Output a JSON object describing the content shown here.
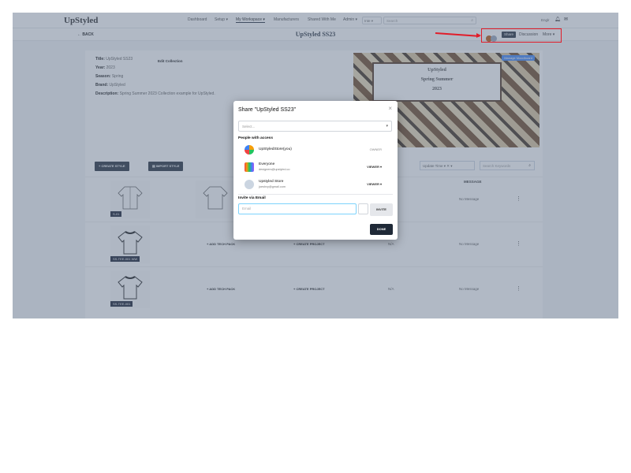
{
  "nav": {
    "logo": "UpStyled",
    "items": [
      "Dashboard",
      "Setup ▾",
      "My Workspace ▾",
      "Manufacturers",
      "Shared With Me",
      "Admin ▾"
    ],
    "lang": "Inte ▾",
    "search_placeholder": "Search",
    "right_label": "Englr"
  },
  "header": {
    "back": "← BACK",
    "title": "UpStyled SS23",
    "share": "Share",
    "discussion": "Discussion",
    "more": "More ▾"
  },
  "collection": {
    "title_label": "Title:",
    "title_value": "UpStyled SS23",
    "edit": "Edit Collection",
    "year_label": "Year:",
    "year_value": "2023",
    "season_label": "Season:",
    "season_value": "Spring",
    "brand_label": "Brand:",
    "brand_value": "UpStyled",
    "description_label": "Description:",
    "description_value": "Spring Summer 2023 Collection example for UpStyled.",
    "banner_line1": "UpStyled",
    "banner_line2": "Spring Summer",
    "banner_line3": "2023",
    "manage_moodboard": "Manage Moodboard"
  },
  "toolbar": {
    "create_style": "+ CREATE STYLE",
    "import_style": "▤ IMPORT STYLE",
    "sort": "Update Time ▾   ✕ ▾",
    "search_placeholder": "Search Keywords"
  },
  "table": {
    "headers": [
      "DESIGN",
      "TECH PACK",
      "MESSAGE"
    ],
    "rows": [
      {
        "sku": "S-01",
        "tech_pack": "",
        "project": "",
        "status": "",
        "message": "No Message"
      },
      {
        "sku": "SS-TEE-001 WW",
        "tech_pack": "+ ADD TECH PACK",
        "project": "+ CREATE PROJECT",
        "status": "N/A",
        "message": "No Message"
      },
      {
        "sku": "SS-TEE-001",
        "tech_pack": "+ ADD TECH PACK",
        "project": "+ CREATE PROJECT",
        "status": "N/A",
        "message": "No Message"
      }
    ]
  },
  "modal": {
    "title": "Share \"UpStyled SS23\"",
    "close": "×",
    "select_placeholder": "Select...",
    "people_heading": "People with access",
    "people": [
      {
        "name": "UpStyledStore(you)",
        "email": "",
        "role": "OWNER"
      },
      {
        "name": "Everyone",
        "email": "designers@upstyled.co",
        "role": "VIEWER ▾"
      },
      {
        "name": "Upstyled Store",
        "email": "joeshvy@gmail.com",
        "role": "VIEWER ▾"
      }
    ],
    "invite_heading": "Invite via Email",
    "email_placeholder": "Email",
    "invite_button": "INVITE",
    "done_button": "DONE"
  },
  "colors": {
    "dark": "#1f2937",
    "accent_red": "#e11d2a",
    "moodboard_blue": "#3b82f6",
    "overlay": "rgba(100,116,139,0.5)"
  }
}
